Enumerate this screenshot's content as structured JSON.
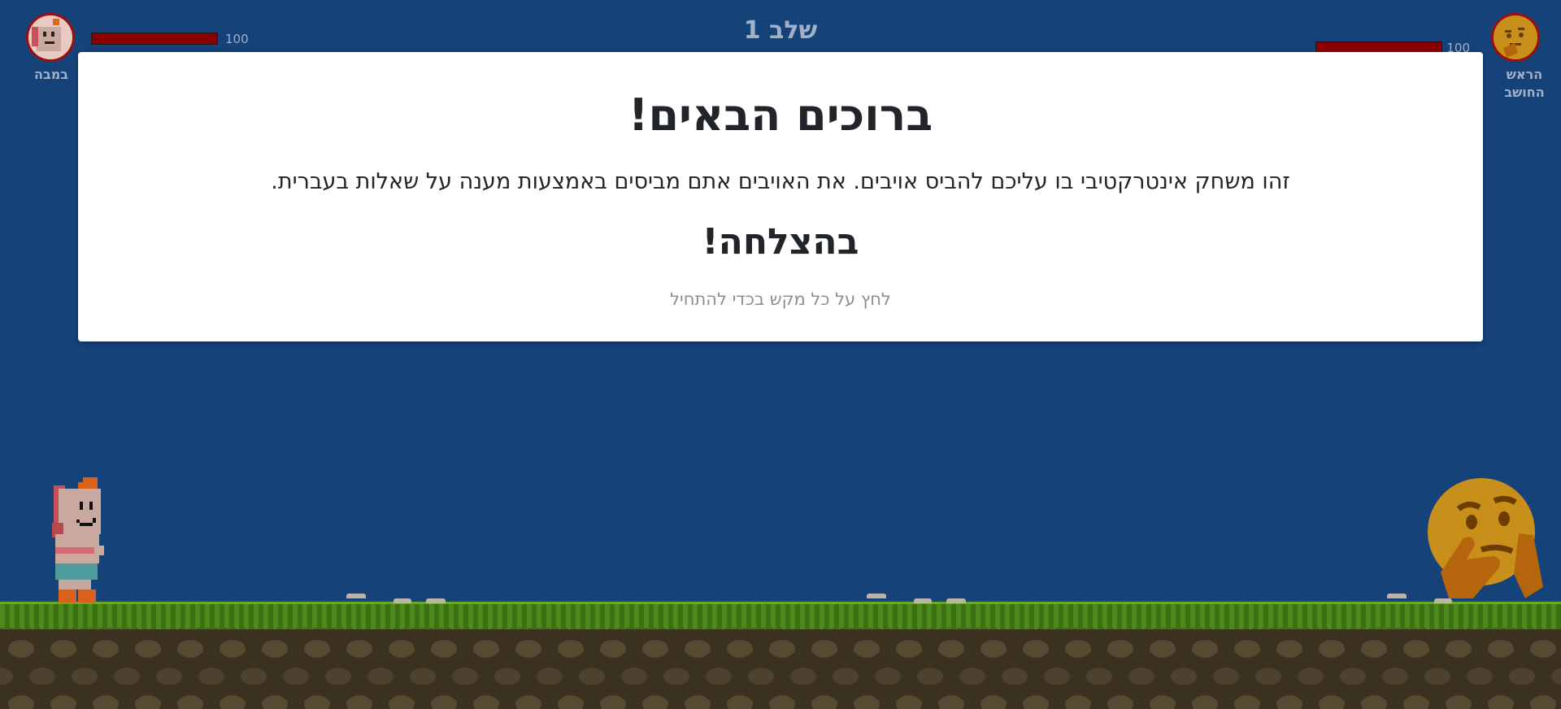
{
  "hud": {
    "stage_label": "שלב 1",
    "player": {
      "name": "במבה",
      "hp_text": "100",
      "hp_fraction": 1.0
    },
    "enemy": {
      "name": "הראש\nהחושב",
      "hp_text": "100",
      "hp_fraction": 1.0
    }
  },
  "modal": {
    "title": "ברוכים הבאים!",
    "description": "זהו משחק אינטרקטיבי בו עליכם להביס אויבים. את האויבים אתם מביסים באמצעות מענה על שאלות בעברית.",
    "good_luck": "בהצלחה!",
    "hint": "לחץ על כל מקש בכדי להתחיל"
  },
  "colors": {
    "sky": "#16427a",
    "hp_fill": "#8a0000",
    "avatar_ring": "#9a0e0e",
    "hud_text": "#9fb0c8",
    "grass": "#4d8a1c",
    "dirt": "#3b3120"
  },
  "icons": {
    "player_sprite": "pixel-boy-icon",
    "enemy_sprite": "thinking-face-emoji-icon"
  }
}
